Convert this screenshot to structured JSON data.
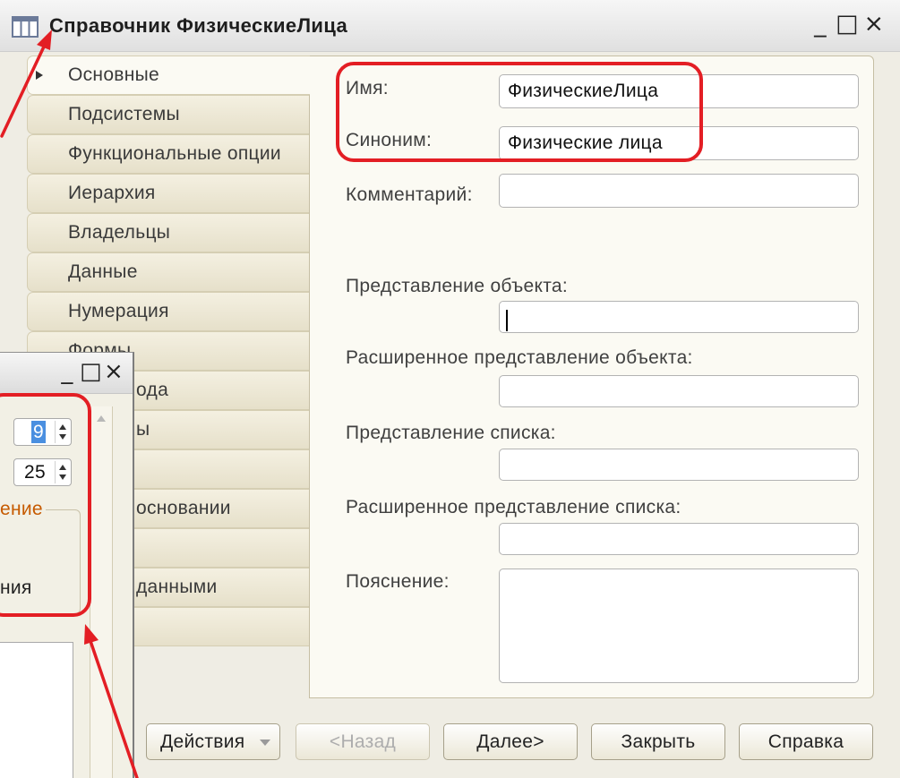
{
  "theme": {
    "annotation_color": "#e31e24",
    "window_background": "#efede4",
    "panel_background": "#fbfaf3",
    "group_caption_color": "#c65a00",
    "selection_color": "#4a8fe0"
  },
  "icons": {
    "title": "table-icon",
    "active_tab_marker": "triangle-right-icon",
    "actions_dropdown": "chevron-down-icon",
    "spin_up": "arrow-up-icon",
    "spin_down": "arrow-down-icon",
    "scroll_up": "scroll-up-icon"
  },
  "main_window": {
    "title": "Справочник ФизическиеЛица",
    "controls": {
      "minimize": "_",
      "maximize": "□",
      "close": "×"
    },
    "tabs": [
      {
        "label": "Основные",
        "active": true
      },
      {
        "label": "Подсистемы"
      },
      {
        "label": "Функциональные опции"
      },
      {
        "label": "Иерархия"
      },
      {
        "label": "Владельцы"
      },
      {
        "label": "Данные"
      },
      {
        "label": "Нумерация"
      },
      {
        "label": "Формы"
      },
      {
        "label": "ода"
      },
      {
        "label": "ы"
      },
      {
        "label": ""
      },
      {
        "label": "основании"
      },
      {
        "label": ""
      },
      {
        "label": "данными"
      },
      {
        "label": ""
      }
    ],
    "fields": {
      "name": {
        "label": "Имя:",
        "value": "ФизическиеЛица"
      },
      "synonym": {
        "label": "Синоним:",
        "value": "Физические лица"
      },
      "comment": {
        "label": "Комментарий:",
        "value": ""
      },
      "object_presentation": {
        "label": "Представление объекта:",
        "value": ""
      },
      "extended_object_presentation": {
        "label": "Расширенное представление объекта:",
        "value": ""
      },
      "list_presentation": {
        "label": "Представление списка:",
        "value": ""
      },
      "extended_list_presentation": {
        "label": "Расширенное представление списка:",
        "value": ""
      },
      "explanation": {
        "label": "Пояснение:",
        "value": ""
      }
    },
    "buttons": {
      "actions": "Действия",
      "back": "<Назад",
      "next": "Далее>",
      "close": "Закрыть",
      "help": "Справка"
    }
  },
  "overlay_window": {
    "controls": {
      "minimize": "_",
      "maximize": "□",
      "close": "×"
    },
    "spin_1_value": "9",
    "spin_2_value": "25",
    "group_caption": "ение",
    "group_text": "ния"
  }
}
